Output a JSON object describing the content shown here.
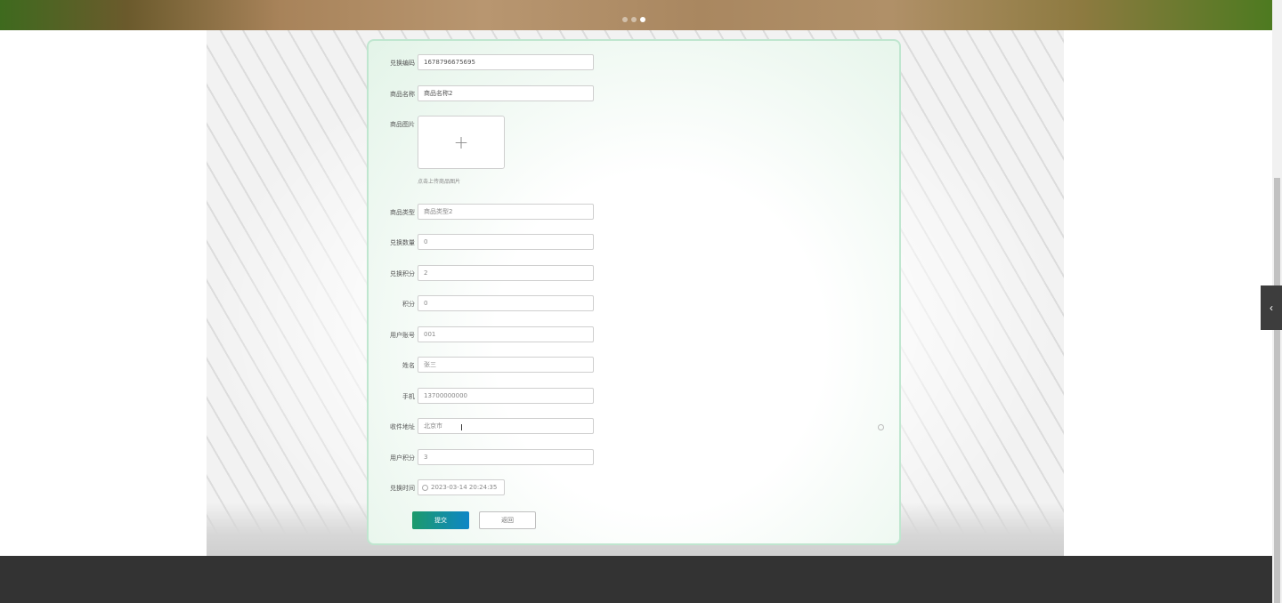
{
  "banner": {
    "dots": 3,
    "active_dot": 2
  },
  "form": {
    "fields": {
      "exchange_code": {
        "label": "兑换编码",
        "value": "1678796675695"
      },
      "product_name": {
        "label": "商品名称",
        "value": "商品名称2"
      },
      "product_image": {
        "label": "商品图片",
        "hint": "点击上传商品图片",
        "icon": "plus-icon"
      },
      "product_type": {
        "label": "商品类型",
        "value": "商品类型2"
      },
      "exchange_qty": {
        "label": "兑换数量",
        "value": "0"
      },
      "exchange_points": {
        "label": "兑换积分",
        "value": "2"
      },
      "points": {
        "label": "积分",
        "value": "0"
      },
      "user_account": {
        "label": "用户账号",
        "value": "001"
      },
      "name": {
        "label": "姓名",
        "value": "张三"
      },
      "phone": {
        "label": "手机",
        "value": "13700000000"
      },
      "address": {
        "label": "收件地址",
        "value": "北京市"
      },
      "user_points": {
        "label": "用户积分",
        "value": "3"
      },
      "exchange_time": {
        "label": "兑换时间",
        "value": "2023-03-14 20:24:35",
        "icon": "clock-icon"
      }
    },
    "submit_label": "提交",
    "back_label": "返回"
  },
  "side_toggle": {
    "icon": "chevron-left-icon",
    "glyph": "‹"
  },
  "cursor": {
    "glyph": "I"
  },
  "colors": {
    "accent_start": "#1c9a6b",
    "accent_end": "#0e86c7",
    "panel_border": "#bfe6cf",
    "footer": "#333333"
  }
}
